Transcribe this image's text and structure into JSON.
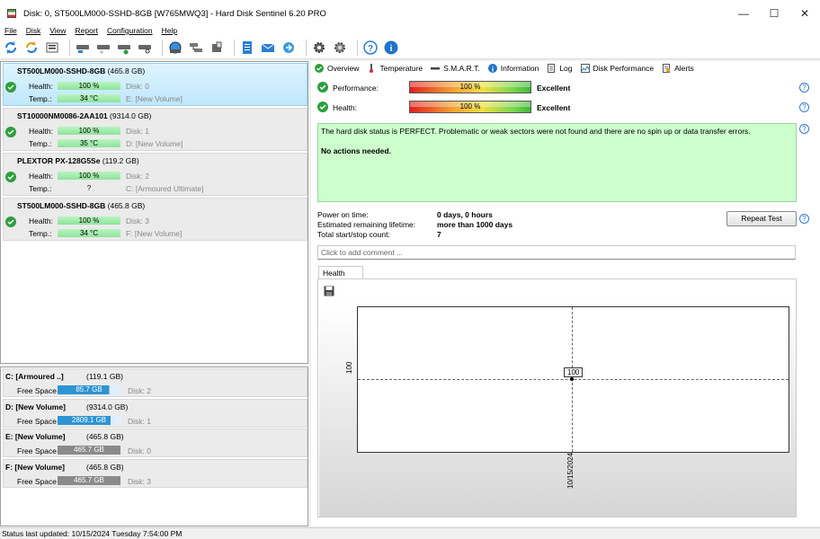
{
  "window": {
    "title": "Disk: 0, ST500LM000-SSHD-8GB [W765MWQ3]  -  Hard Disk Sentinel 6.20 PRO",
    "minimize": "—",
    "maximize": "☐",
    "close": "✕"
  },
  "menu": [
    "File",
    "Disk",
    "View",
    "Report",
    "Configuration",
    "Help"
  ],
  "disks": [
    {
      "name": "ST500LM000-SSHD-8GB",
      "size": "(465.8 GB)",
      "health_label": "Health:",
      "health": "100 %",
      "disk": "Disk: 0",
      "temp_label": "Temp.:",
      "temp": "34 °C",
      "volume": "E: [New Volume]",
      "selected": true
    },
    {
      "name": "ST10000NM0086-2AA101",
      "size": "(9314.0 GB)",
      "health_label": "Health:",
      "health": "100 %",
      "disk": "Disk: 1",
      "temp_label": "Temp.:",
      "temp": "35 °C",
      "volume": "D: [New Volume]",
      "selected": false
    },
    {
      "name": "PLEXTOR PX-128G5Se",
      "size": "(119.2 GB)",
      "health_label": "Health:",
      "health": "100 %",
      "disk": "Disk: 2",
      "temp_label": "Temp.:",
      "temp": "?",
      "volume": "C: [Armoured Ultimate]",
      "selected": false
    },
    {
      "name": "ST500LM000-SSHD-8GB",
      "size": "(465.8 GB)",
      "health_label": "Health:",
      "health": "100 %",
      "disk": "Disk: 3",
      "temp_label": "Temp.:",
      "temp": "34 °C",
      "volume": "F: [New Volume]",
      "selected": false
    }
  ],
  "volumes": [
    {
      "name": "C: [Armoured ..]",
      "size": "(119.1 GB)",
      "free_label": "Free Space",
      "free": "85.7 GB",
      "disk": "Disk: 2",
      "color": "#2e94d2"
    },
    {
      "name": "D: [New Volume]",
      "size": "(9314.0 GB)",
      "free_label": "Free Space",
      "free": "2809.1 GB",
      "disk": "Disk: 1",
      "color": "#2e94d2"
    },
    {
      "name": "E: [New Volume]",
      "size": "(465.8 GB)",
      "free_label": "Free Space",
      "free": "465.7 GB",
      "disk": "Disk: 0",
      "color": "#8a8a8a"
    },
    {
      "name": "F: [New Volume]",
      "size": "(465.8 GB)",
      "free_label": "Free Space",
      "free": "465.7 GB",
      "disk": "Disk: 3",
      "color": "#8a8a8a"
    }
  ],
  "tabs": [
    {
      "label": "Overview",
      "icon": "check-circle-icon"
    },
    {
      "label": "Temperature",
      "icon": "thermometer-icon"
    },
    {
      "label": "S.M.A.R.T.",
      "icon": "dash-icon"
    },
    {
      "label": "Information",
      "icon": "info-icon"
    },
    {
      "label": "Log",
      "icon": "document-icon"
    },
    {
      "label": "Disk Performance",
      "icon": "chart-icon"
    },
    {
      "label": "Alerts",
      "icon": "alert-doc-icon"
    }
  ],
  "overview": {
    "performance_label": "Performance:",
    "performance_value": "100 %",
    "performance_rating": "Excellent",
    "health_label": "Health:",
    "health_value": "100 %",
    "health_rating": "Excellent",
    "status_text": "The hard disk status is PERFECT. Problematic or weak sectors were not found and there are no spin up or data transfer errors.",
    "actions_text": "No actions needed.",
    "power_on_label": "Power on time:",
    "power_on_value": "0 days, 0 hours",
    "remaining_label": "Estimated remaining lifetime:",
    "remaining_value": "more than 1000 days",
    "startstop_label": "Total start/stop count:",
    "startstop_value": "7",
    "repeat_test_label": "Repeat Test",
    "comment_placeholder": "Click to add comment ..."
  },
  "health_chart_tab": "Health (%)",
  "chart_data": {
    "type": "line",
    "x": [
      "10/15/2024"
    ],
    "series": [
      {
        "values": [
          100
        ]
      }
    ],
    "xlabel": "",
    "ylabel": "",
    "y_tick_labels": [
      "100"
    ],
    "x_tick_labels": [
      "10/15/2024"
    ],
    "point_labels": [
      "100"
    ],
    "grid": true
  },
  "status_bar": "Status last updated: 10/15/2024 Tuesday 7:54:00 PM"
}
